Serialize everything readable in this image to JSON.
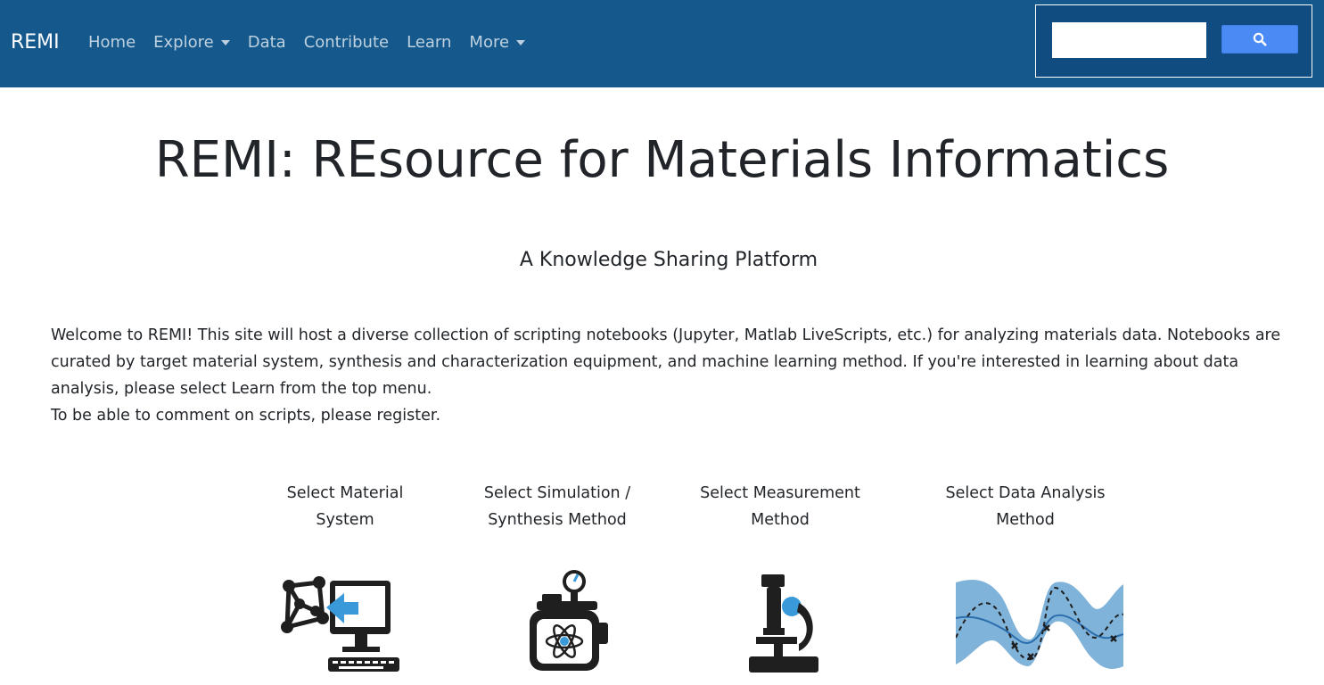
{
  "navbar": {
    "brand": "REMI",
    "links": [
      {
        "label": "Home",
        "dropdown": false
      },
      {
        "label": "Explore",
        "dropdown": true
      },
      {
        "label": "Data",
        "dropdown": false
      },
      {
        "label": "Contribute",
        "dropdown": false
      },
      {
        "label": "Learn",
        "dropdown": false
      },
      {
        "label": "More",
        "dropdown": true
      }
    ],
    "search": {
      "placeholder": "",
      "button_icon": "search-icon"
    },
    "colors": {
      "background": "#14588c",
      "search_button": "#4a8af4"
    }
  },
  "main": {
    "title": "REMI: REsource for Materials Informatics",
    "subtitle": "A Knowledge Sharing Platform",
    "intro": "Welcome to REMI! This site will host a diverse collection of scripting notebooks (Jupyter, Matlab LiveScripts, etc.) for analyzing materials data. Notebooks are curated by target material system, synthesis and characterization equipment, and machine learning method. If you're interested in learning about data analysis, please select Learn from the top menu.",
    "register_note": "To be able to comment on scripts, please register.",
    "cards": [
      {
        "line1": "Select Material",
        "line2": "System",
        "icon": "material-system-computer-icon"
      },
      {
        "line1": "Select Simulation /",
        "line2": "Synthesis Method",
        "icon": "synthesis-reactor-icon"
      },
      {
        "line1": "Select Measurement",
        "line2": "Method",
        "icon": "microscope-icon"
      },
      {
        "line1": "Select Data Analysis",
        "line2": "Method",
        "icon": "gaussian-process-plot-icon"
      }
    ]
  }
}
